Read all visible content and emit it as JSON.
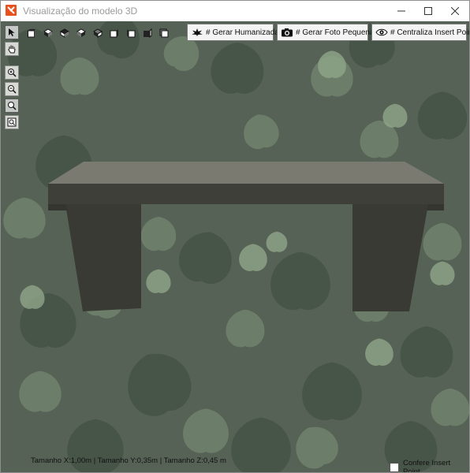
{
  "window": {
    "title": "Visualização do modelo 3D"
  },
  "left_toolbar": {
    "tools": [
      {
        "name": "select-tool",
        "icon": "pointer-arrow-icon"
      },
      {
        "name": "pan-tool",
        "icon": "hand-icon"
      },
      {
        "name": "zoom-in-tool",
        "icon": "zoom-in-icon"
      },
      {
        "name": "zoom-out-tool",
        "icon": "zoom-out-icon"
      },
      {
        "name": "zoom-tool",
        "icon": "magnifier-icon"
      },
      {
        "name": "zoom-extents-tool",
        "icon": "zoom-extents-icon"
      }
    ]
  },
  "view_toolbar": {
    "views": [
      "view-top-icon",
      "view-iso-sw-icon",
      "view-iso-se-icon",
      "view-iso-ne-icon",
      "view-iso-nw-icon",
      "view-front-icon",
      "view-left-icon",
      "view-right-icon",
      "view-back-icon"
    ]
  },
  "actions": {
    "humanize_label": "# Gerar Humanizada",
    "small_photo_label": "# Gerar Foto Pequena",
    "center_label": "# Centraliza Insert Point"
  },
  "status": {
    "dimensions": "Tamanho X:1,00m | Tamanho Y:0,35m | Tamanho Z:0,45 m",
    "insert_point_label": "Confere Insert Point",
    "insert_point_checked": false
  },
  "colors": {
    "accent": "#e8511e",
    "leaf_dark": "#3d4a3e",
    "leaf_light": "#7f9478",
    "bench_top": "#7d7d74",
    "bench_front": "#3b3c35"
  }
}
